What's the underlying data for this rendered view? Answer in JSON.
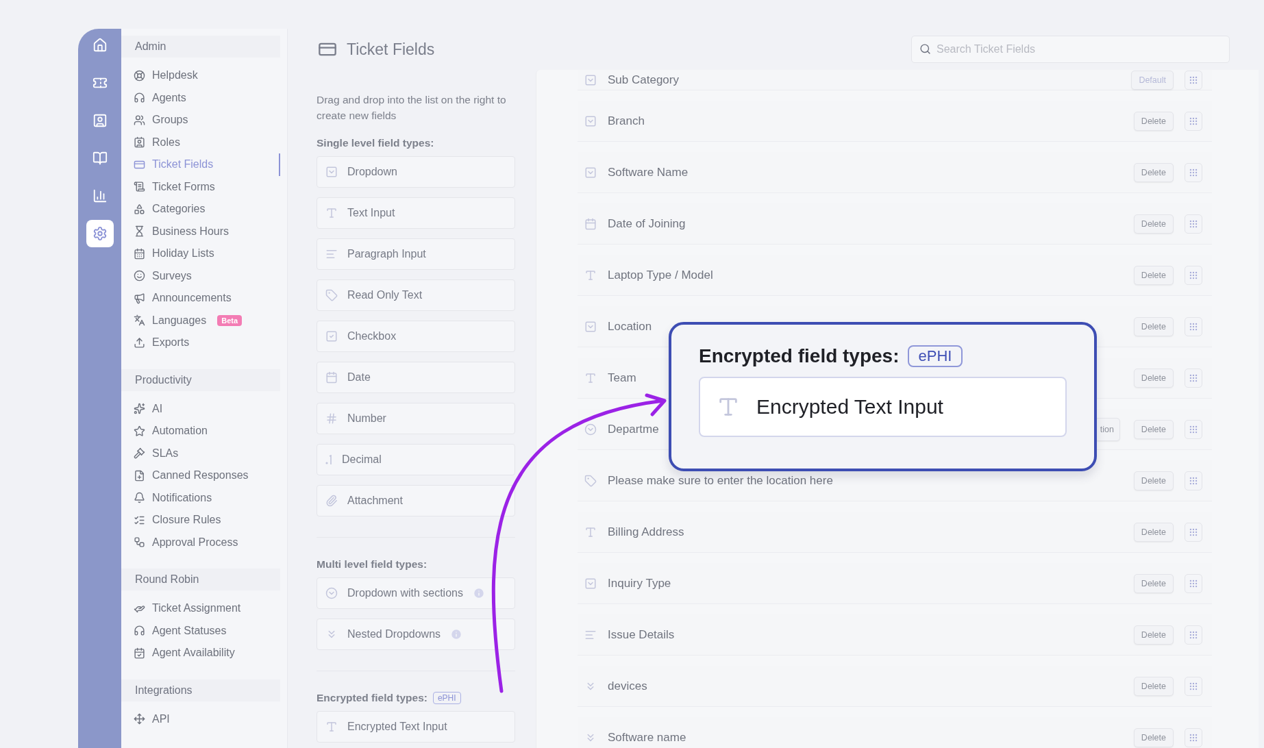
{
  "rail": {
    "items": [
      {
        "selected": false
      },
      {
        "selected": false
      },
      {
        "selected": false
      },
      {
        "selected": false
      },
      {
        "selected": false
      },
      {
        "selected": true
      }
    ]
  },
  "sidebar": {
    "sections": [
      {
        "title": "Admin",
        "items": [
          {
            "label": "Helpdesk",
            "selected": false
          },
          {
            "label": "Agents",
            "selected": false
          },
          {
            "label": "Groups",
            "selected": false
          },
          {
            "label": "Roles",
            "selected": false
          },
          {
            "label": "Ticket Fields",
            "selected": true
          },
          {
            "label": "Ticket Forms",
            "selected": false
          },
          {
            "label": "Categories",
            "selected": false
          },
          {
            "label": "Business Hours",
            "selected": false
          },
          {
            "label": "Holiday Lists",
            "selected": false
          },
          {
            "label": "Surveys",
            "selected": false
          },
          {
            "label": "Announcements",
            "selected": false
          },
          {
            "label": "Languages",
            "selected": false,
            "badge": "Beta"
          },
          {
            "label": "Exports",
            "selected": false
          }
        ]
      },
      {
        "title": "Productivity",
        "items": [
          {
            "label": "AI",
            "selected": false
          },
          {
            "label": "Automation",
            "selected": false
          },
          {
            "label": "SLAs",
            "selected": false
          },
          {
            "label": "Canned Responses",
            "selected": false
          },
          {
            "label": "Notifications",
            "selected": false
          },
          {
            "label": "Closure Rules",
            "selected": false
          },
          {
            "label": "Approval Process",
            "selected": false
          }
        ]
      },
      {
        "title": "Round Robin",
        "items": [
          {
            "label": "Ticket Assignment",
            "selected": false
          },
          {
            "label": "Agent Statuses",
            "selected": false
          },
          {
            "label": "Agent Availability",
            "selected": false
          }
        ]
      },
      {
        "title": "Integrations",
        "items": [
          {
            "label": "API",
            "selected": false
          }
        ]
      }
    ]
  },
  "header": {
    "title": "Ticket Fields",
    "search": {
      "placeholder": "Search Ticket Fields"
    }
  },
  "palette": {
    "hint": "Drag and drop into the list on the right to create new fields",
    "groups": [
      {
        "title": "Single level field types:",
        "items": [
          {
            "label": "Dropdown",
            "kind": "dropdown",
            "info": false
          },
          {
            "label": "Text Input",
            "kind": "text",
            "info": false
          },
          {
            "label": "Paragraph Input",
            "kind": "paragraph",
            "info": false
          },
          {
            "label": "Read Only Text",
            "kind": "readonly",
            "info": false
          },
          {
            "label": "Checkbox",
            "kind": "checkbox",
            "info": false
          },
          {
            "label": "Date",
            "kind": "date",
            "info": false
          },
          {
            "label": "Number",
            "kind": "number",
            "info": false
          },
          {
            "label": "Decimal",
            "kind": "decimal",
            "info": false
          },
          {
            "label": "Attachment",
            "kind": "attachment",
            "info": false
          }
        ]
      },
      {
        "title": "Multi level field types:",
        "items": [
          {
            "label": "Dropdown with sections",
            "kind": "sections",
            "info": true
          },
          {
            "label": "Nested Dropdowns",
            "kind": "nested",
            "info": true
          }
        ]
      },
      {
        "title": "Encrypted field types:",
        "badge": "ePHI",
        "items": [
          {
            "label": "Encrypted Text Input",
            "kind": "text",
            "info": false
          }
        ]
      }
    ]
  },
  "fields": [
    {
      "label": "Sub Category",
      "kind": "dropdown",
      "buttons": [
        "Default"
      ]
    },
    {
      "label": "Branch",
      "kind": "dropdown",
      "buttons": [
        "Delete"
      ]
    },
    {
      "label": "Software Name",
      "kind": "dropdown",
      "buttons": [
        "Delete"
      ]
    },
    {
      "label": "Date of Joining",
      "kind": "date",
      "buttons": [
        "Delete"
      ]
    },
    {
      "label": "Laptop Type / Model",
      "kind": "text",
      "buttons": [
        "Delete"
      ]
    },
    {
      "label": "Location",
      "kind": "dropdown",
      "buttons": [
        "Delete"
      ]
    },
    {
      "label": "Team",
      "kind": "text",
      "buttons": [
        "Delete"
      ]
    },
    {
      "label": "Departme",
      "kind": "sections",
      "buttons": [
        "tion",
        "Delete"
      ]
    },
    {
      "label": "Please make sure to enter the location here",
      "kind": "readonly",
      "buttons": [
        "Delete"
      ]
    },
    {
      "label": "Billing Address",
      "kind": "text",
      "buttons": [
        "Delete"
      ]
    },
    {
      "label": "Inquiry Type",
      "kind": "dropdown",
      "buttons": [
        "Delete"
      ]
    },
    {
      "label": "Issue Details",
      "kind": "paragraph",
      "buttons": [
        "Delete"
      ]
    },
    {
      "label": "devices",
      "kind": "nested",
      "buttons": [
        "Delete"
      ]
    },
    {
      "label": "Software name",
      "kind": "nested",
      "buttons": [
        "Delete"
      ]
    }
  ],
  "callout": {
    "title": "Encrypted field types:",
    "badge": "ePHI",
    "item": {
      "label": "Encrypted Text Input",
      "kind": "text"
    }
  }
}
